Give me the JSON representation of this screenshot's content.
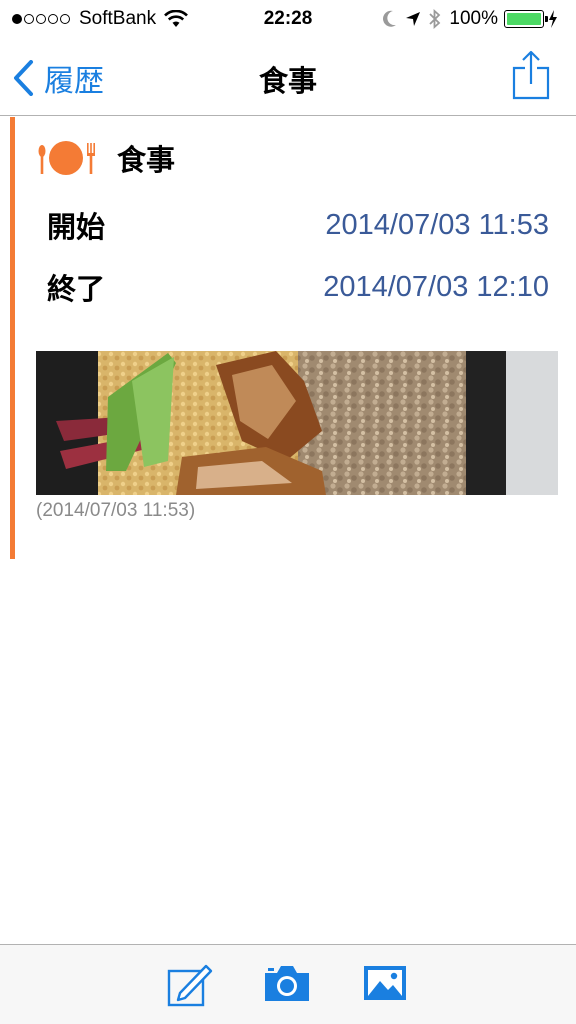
{
  "status_bar": {
    "carrier": "SoftBank",
    "time": "22:28",
    "battery_percent": "100%",
    "battery_level": 1.0
  },
  "nav": {
    "back_label": "履歴",
    "title": "食事"
  },
  "entry": {
    "title": "食事",
    "accent_color": "#f47b35",
    "rows": [
      {
        "label": "開始",
        "value": "2014/07/03 11:53"
      },
      {
        "label": "終了",
        "value": "2014/07/03 12:10"
      }
    ],
    "photo_caption": "(2014/07/03 11:53)"
  },
  "toolbar": {
    "items": [
      "edit-icon",
      "camera-icon",
      "photo-library-icon"
    ],
    "accent_color": "#1a7fe0"
  }
}
